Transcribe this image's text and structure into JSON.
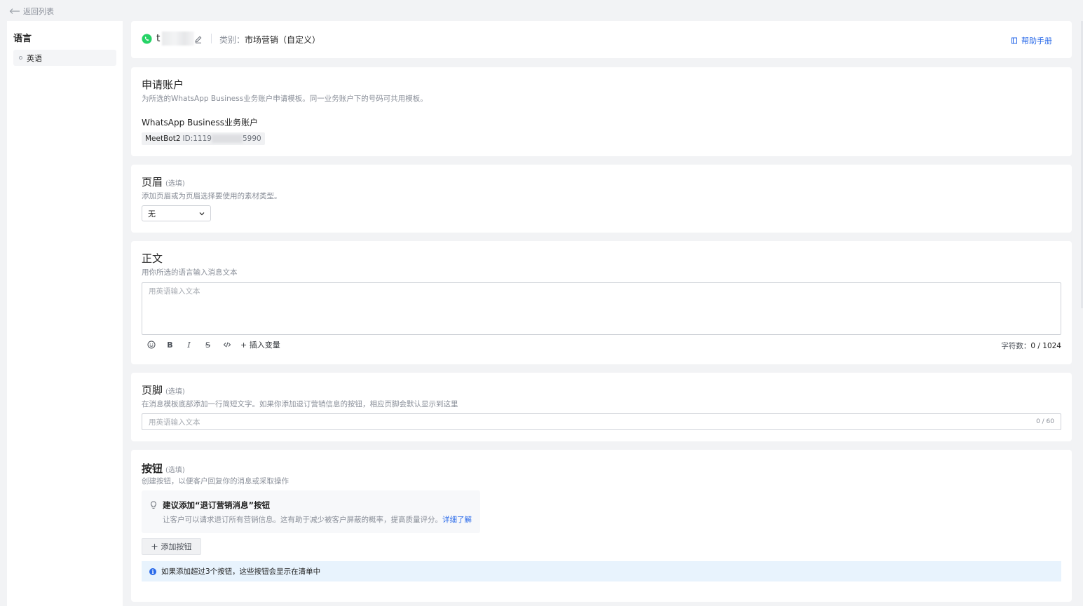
{
  "nav": {
    "back_label": "返回列表"
  },
  "sidebar": {
    "title": "语言",
    "items": [
      {
        "label": "英语",
        "selected": true
      }
    ]
  },
  "header": {
    "template_name_prefix": "t",
    "category_label": "类别：",
    "category_value": "市场营销（自定义）",
    "help_label": "帮助手册"
  },
  "account_section": {
    "title": "申请账户",
    "description": "为所选的WhatsApp Business业务账户申请模板。同一业务账户下的号码可共用模板。",
    "account_label": "WhatsApp Business业务账户",
    "account_name": "MeetBot2",
    "account_id_prefix": "ID:1119",
    "account_id_suffix": "5990"
  },
  "header_section": {
    "title": "页眉",
    "optional": "(选填)",
    "description": "添加页眉或为页眉选择要使用的素材类型。",
    "select_value": "无"
  },
  "body_section": {
    "title": "正文",
    "description": "用你所选的语言输入消息文本",
    "placeholder": "用英语输入文本",
    "toolbar": {
      "bold": "B",
      "italic": "I",
      "strike": "S",
      "insert_variable": "+ 插入变量"
    },
    "char_count_label": "字符数：",
    "char_count_value": "0 / 1024"
  },
  "footer_section": {
    "title": "页脚",
    "optional": "(选填)",
    "description": "在消息模板底部添加一行简短文字。如果你添加退订营销信息的按钮，相应页脚会默认显示到这里",
    "placeholder": "用英语输入文本",
    "count": "0 / 60"
  },
  "buttons_section": {
    "title": "按钮",
    "optional": "(选填)",
    "description": "创建按钮，以便客户回复你的消息或采取操作",
    "suggest_title": "建议添加“退订营销消息”按钮",
    "suggest_desc": "让客户可以请求退订所有营销信息。这有助于减少被客户屏蔽的概率，提高质量评分。",
    "suggest_link": "详细了解",
    "add_button_label": "添加按钮",
    "notice": "如果添加超过3个按钮，这些按钮会显示在清单中"
  },
  "colors": {
    "accent": "#2a6ae9",
    "whatsapp": "#25d366",
    "notice_bg": "#e8f3fd"
  }
}
